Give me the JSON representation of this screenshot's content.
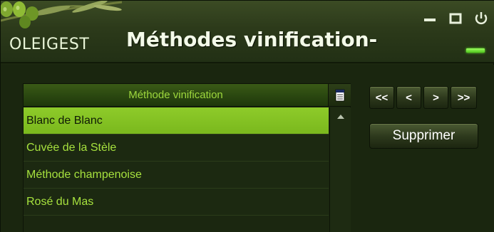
{
  "window": {
    "brand": "OLEIGEST",
    "title": "Méthodes vinification-",
    "controls": {
      "minimize_icon": "minimize-icon",
      "maximize_icon": "maximize-icon",
      "power_icon": "power-icon"
    }
  },
  "grid": {
    "header_label": "Méthode vinification",
    "header_icon": "document-icon",
    "rows": [
      {
        "label": "Blanc de Blanc",
        "selected": true
      },
      {
        "label": "Cuvée de la Stèle",
        "selected": false
      },
      {
        "label": "Méthode champenoise",
        "selected": false
      },
      {
        "label": "Rosé du Mas",
        "selected": false
      }
    ]
  },
  "navigation": {
    "first": "<<",
    "previous": "<",
    "next": ">",
    "last": ">>"
  },
  "actions": {
    "delete_label": "Supprimer"
  },
  "colors": {
    "background": "#1a260f",
    "accent": "#8ecb2a",
    "row_text": "#a7e23e",
    "header_text": "#9ed83d",
    "status_led": "#6eff2f"
  }
}
